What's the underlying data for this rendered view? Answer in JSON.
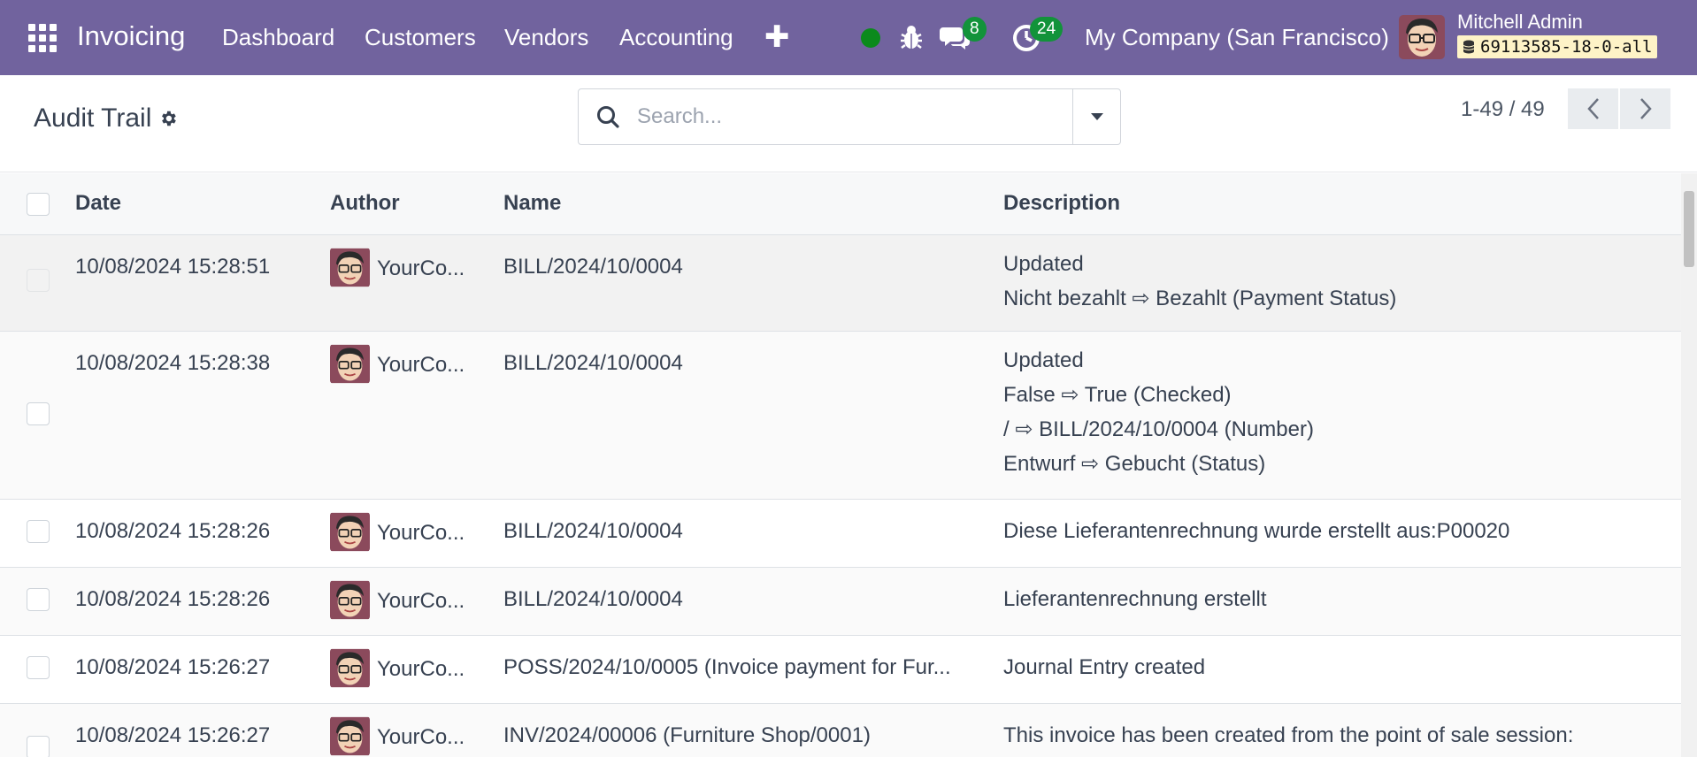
{
  "navbar": {
    "app_name": "Invoicing",
    "menu": [
      "Dashboard",
      "Customers",
      "Vendors",
      "Accounting"
    ],
    "messages_count": "8",
    "activities_count": "24",
    "company": "My Company (San Francisco)",
    "user_name": "Mitchell Admin",
    "database": "69113585-18-0-all",
    "status_color": "#0b8a1c",
    "bar_color": "#71639e"
  },
  "control": {
    "title": "Audit Trail",
    "search_placeholder": "Search...",
    "pager": "1-49 / 49"
  },
  "table": {
    "headers": [
      "Date",
      "Author",
      "Name",
      "Description"
    ],
    "rows": [
      {
        "date": "10/08/2024 15:28:51",
        "author": "YourCo...",
        "name": "BILL/2024/10/0004",
        "desc": [
          "Updated",
          "Nicht bezahlt ⇨ Bezahlt (Payment Status)"
        ]
      },
      {
        "date": "10/08/2024 15:28:38",
        "author": "YourCo...",
        "name": "BILL/2024/10/0004",
        "desc": [
          "Updated",
          "False ⇨ True (Checked)",
          "/ ⇨ BILL/2024/10/0004 (Number)",
          "Entwurf ⇨ Gebucht (Status)"
        ]
      },
      {
        "date": "10/08/2024 15:28:26",
        "author": "YourCo...",
        "name": "BILL/2024/10/0004",
        "desc": [
          "Diese Lieferantenrechnung wurde erstellt aus:P00020"
        ]
      },
      {
        "date": "10/08/2024 15:28:26",
        "author": "YourCo...",
        "name": "BILL/2024/10/0004",
        "desc": [
          "Lieferantenrechnung erstellt"
        ]
      },
      {
        "date": "10/08/2024 15:26:27",
        "author": "YourCo...",
        "name": "POSS/2024/10/0005 (Invoice payment for Fur...",
        "desc": [
          "Journal Entry created"
        ]
      },
      {
        "date": "10/08/2024 15:26:27",
        "author": "YourCo...",
        "name": "INV/2024/00006 (Furniture Shop/0001)",
        "desc": [
          "This invoice has been created from the point of sale session:"
        ]
      }
    ]
  }
}
